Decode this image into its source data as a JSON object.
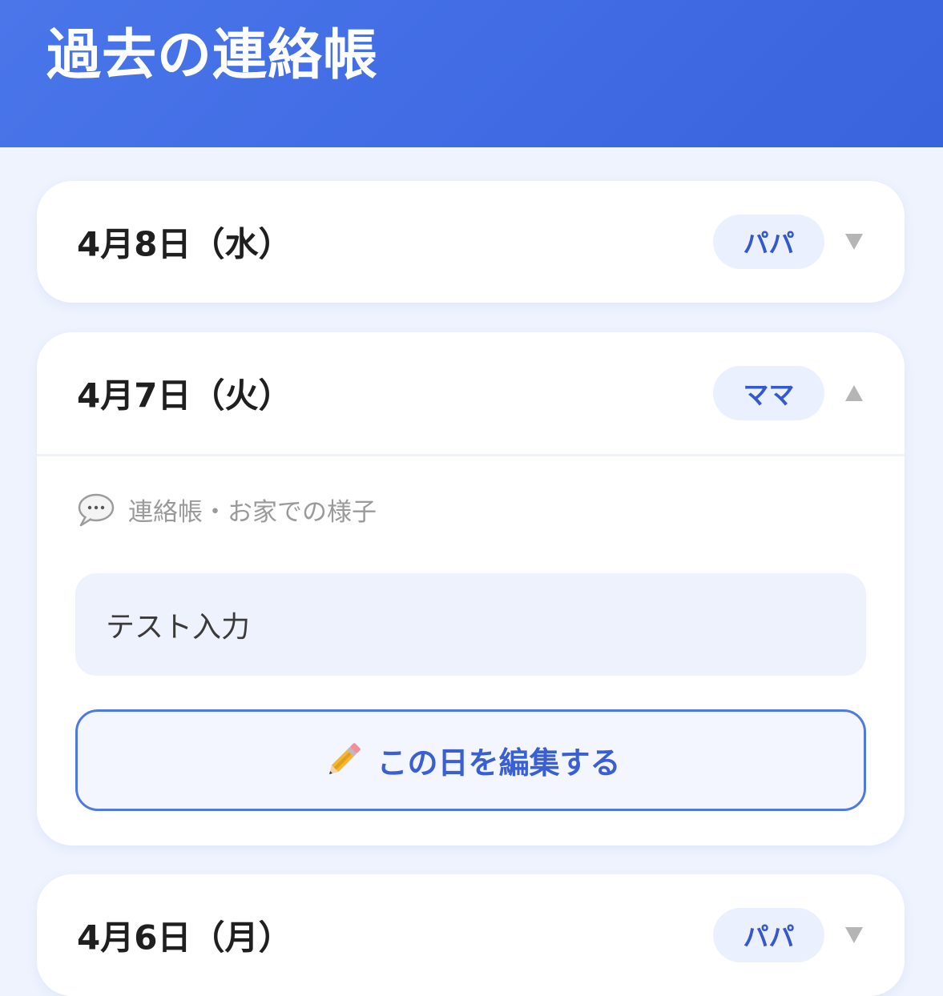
{
  "header": {
    "title": "過去の連絡帳"
  },
  "entries": [
    {
      "date": "4月8日（水）",
      "author": "パパ",
      "expanded": false,
      "chevron_icon": "chevron-down-icon"
    },
    {
      "date": "4月7日（火）",
      "author": "ママ",
      "expanded": true,
      "chevron_icon": "chevron-up-icon",
      "section_label": "連絡帳・お家での様子",
      "section_icon": "speech-bubble-icon",
      "note": "テスト入力",
      "edit_button_label": "この日を編集する",
      "edit_button_icon": "pencil-icon"
    },
    {
      "date": "4月6日（月）",
      "author": "パパ",
      "expanded": false,
      "chevron_icon": "chevron-down-icon"
    }
  ],
  "colors": {
    "header_bg": "#4270e6",
    "page_bg": "#eef3fe",
    "badge_bg": "#eaf0fd",
    "badge_text": "#3558cf",
    "button_border": "#4d79e0",
    "chevron": "#b5b5b5"
  }
}
